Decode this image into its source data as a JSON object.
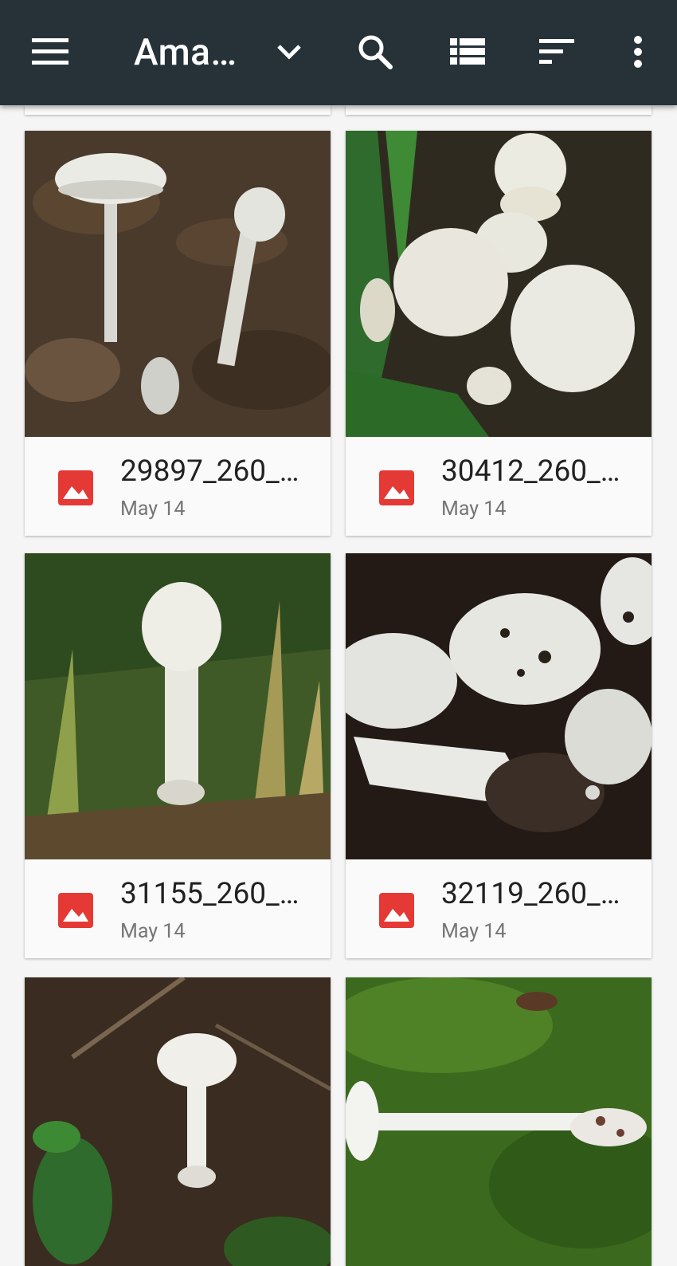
{
  "appbar": {
    "title": "Ama…",
    "icons": [
      "menu-icon",
      "dropdown-chevron-icon",
      "search-icon",
      "view-list-icon",
      "sort-icon",
      "more-vert-icon"
    ]
  },
  "files": [
    {
      "name": "29897_260_…",
      "date": "May 14",
      "icon": "image-file-icon"
    },
    {
      "name": "30412_260_…",
      "date": "May 14",
      "icon": "image-file-icon"
    },
    {
      "name": "31155_260_…",
      "date": "May 14",
      "icon": "image-file-icon"
    },
    {
      "name": "32119_260_…",
      "date": "May 14",
      "icon": "image-file-icon"
    },
    {
      "name": "",
      "date": "",
      "icon": "image-file-icon"
    },
    {
      "name": "",
      "date": "",
      "icon": "image-file-icon"
    }
  ],
  "colors": {
    "appbar": "#263238",
    "file_icon": "#e53935",
    "background": "#f5f5f5"
  }
}
